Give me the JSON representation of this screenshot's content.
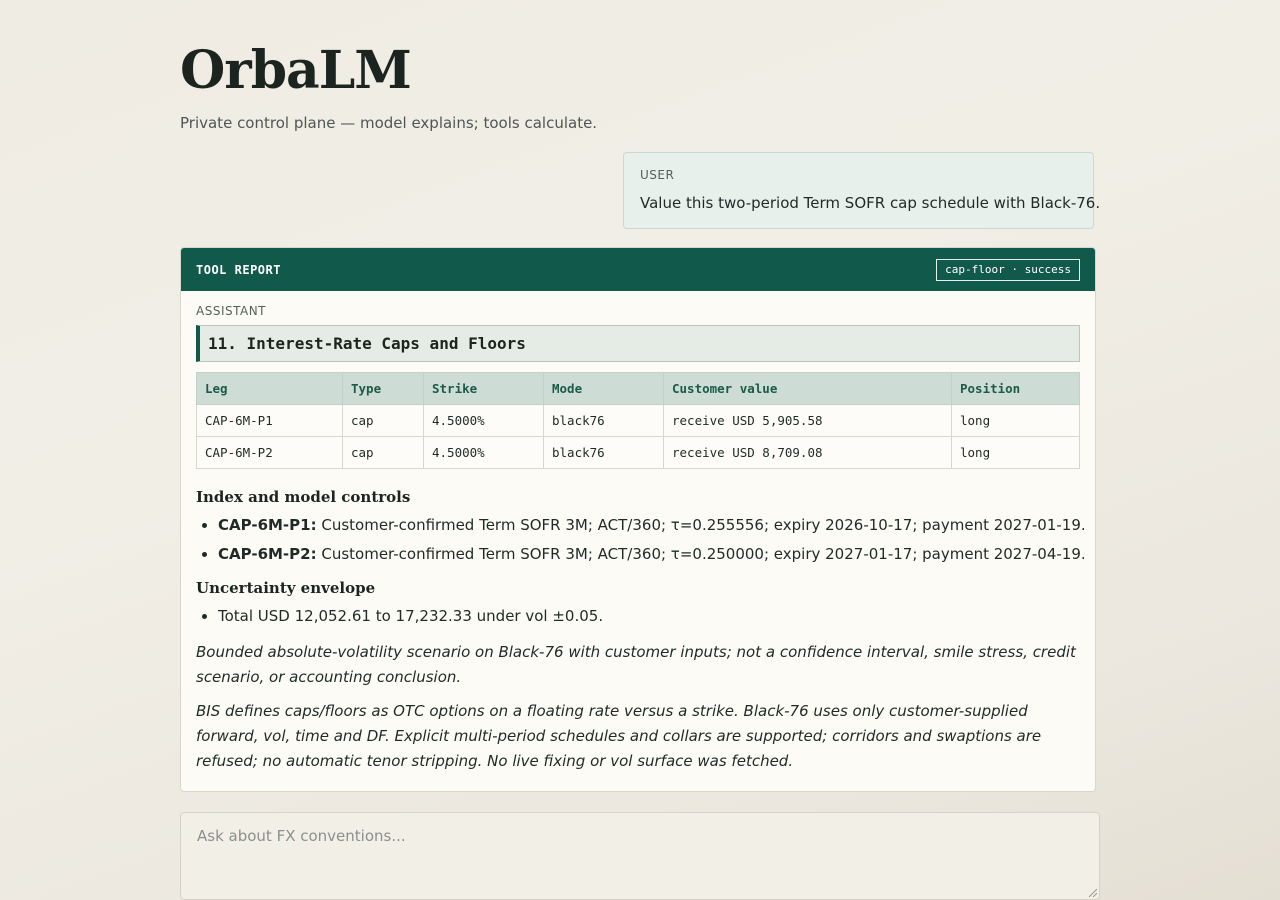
{
  "header": {
    "title": "OrbaLM",
    "subtitle": "Private control plane — model explains; tools calculate."
  },
  "user_message": {
    "role": "USER",
    "text": "Value this two-period Term SOFR cap schedule with Black-76."
  },
  "tool_report": {
    "title": "TOOL REPORT",
    "status": "cap-floor · success",
    "role": "ASSISTANT",
    "section_title": "11. Interest-Rate Caps and Floors",
    "table": {
      "columns": [
        "Leg",
        "Type",
        "Strike",
        "Mode",
        "Customer value",
        "Position"
      ],
      "rows": [
        [
          "CAP-6M-P1",
          "cap",
          "4.5000%",
          "black76",
          "receive USD 5,905.58",
          "long"
        ],
        [
          "CAP-6M-P2",
          "cap",
          "4.5000%",
          "black76",
          "receive USD 8,709.08",
          "long"
        ]
      ]
    },
    "index_controls": {
      "heading": "Index and model controls",
      "items": [
        {
          "key": "CAP-6M-P1:",
          "text": " Customer-confirmed Term SOFR 3M; ACT/360; τ=0.255556; expiry 2026-10-17; payment 2027-01-19."
        },
        {
          "key": "CAP-6M-P2:",
          "text": " Customer-confirmed Term SOFR 3M; ACT/360; τ=0.250000; expiry 2027-01-17; payment 2027-04-19."
        }
      ]
    },
    "uncertainty": {
      "heading": "Uncertainty envelope",
      "items": [
        "Total USD 12,052.61 to 17,232.33 under vol ±0.05."
      ]
    },
    "notes": [
      "Bounded absolute-volatility scenario on Black-76 with customer inputs; not a confidence interval, smile stress, credit scenario, or accounting conclusion.",
      "BIS defines caps/floors as OTC options on a floating rate versus a strike. Black-76 uses only customer-supplied forward, vol, time and DF. Explicit multi-period schedules and collars are supported; corridors and swaptions are refused; no automatic tenor stripping. No live fixing or vol surface was fetched."
    ]
  },
  "composer": {
    "value": "",
    "placeholder": "Ask about FX conventions..."
  },
  "colors": {
    "accent": "#115a4b",
    "user_bubble": "#e8f0ec",
    "table_header": "#cddcd4"
  }
}
